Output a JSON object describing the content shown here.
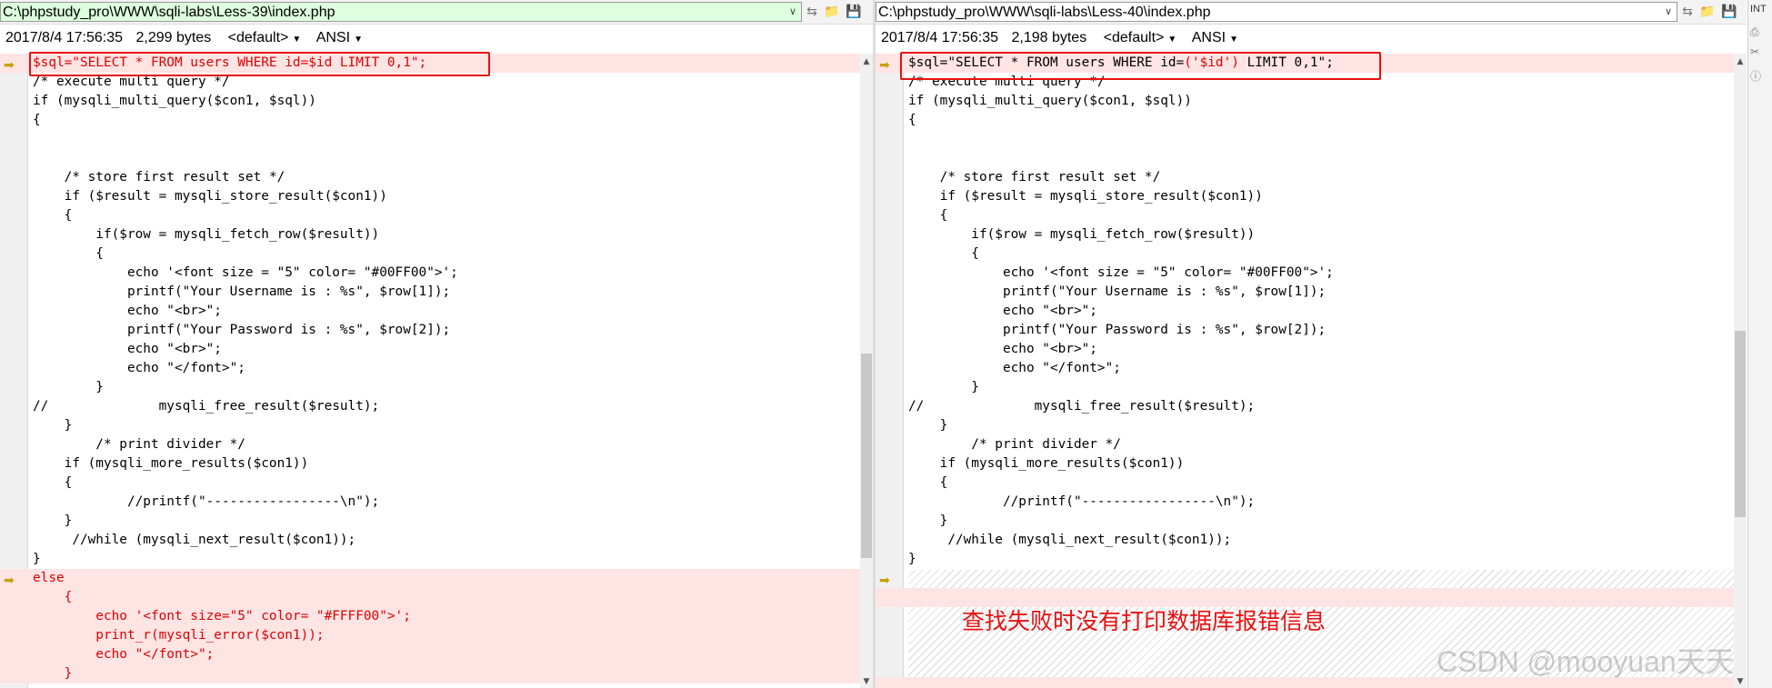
{
  "left": {
    "path": "C:\\phpstudy_pro\\WWW\\sqli-labs\\Less-39\\index.php",
    "timestamp": "2017/8/4 17:56:35",
    "size": "2,299 bytes",
    "view_mode": "<default>",
    "encoding": "ANSI",
    "lines": [
      "$sql=\"SELECT * FROM users WHERE id=$id LIMIT 0,1\";",
      "/* execute multi query */",
      "if (mysqli_multi_query($con1, $sql))",
      "{",
      "",
      "",
      "    /* store first result set */",
      "    if ($result = mysqli_store_result($con1))",
      "    {",
      "        if($row = mysqli_fetch_row($result))",
      "        {",
      "            echo '<font size = \"5\" color= \"#00FF00\">';",
      "            printf(\"Your Username is : %s\", $row[1]);",
      "            echo \"<br>\";",
      "            printf(\"Your Password is : %s\", $row[2]);",
      "            echo \"<br>\";",
      "            echo \"</font>\";",
      "        }",
      "//              mysqli_free_result($result);",
      "    }",
      "        /* print divider */",
      "    if (mysqli_more_results($con1))",
      "    {",
      "            //printf(\"-----------------\\n\");",
      "    }",
      "     //while (mysqli_next_result($con1));",
      "}",
      "else",
      "    {",
      "        echo '<font size=\"5\" color= \"#FFFF00\">';",
      "        print_r(mysqli_error($con1));",
      "        echo \"</font>\";",
      "    }"
    ]
  },
  "right": {
    "path": "C:\\phpstudy_pro\\WWW\\sqli-labs\\Less-40\\index.php",
    "timestamp": "2017/8/4 17:56:35",
    "size": "2,198 bytes",
    "view_mode": "<default>",
    "encoding": "ANSI",
    "sql_prefix": "$sql=\"SELECT * FROM users WHERE id=",
    "sql_changed": "('$id')",
    "sql_suffix": " LIMIT 0,1\";",
    "lines": [
      "",
      "/* execute multi query */",
      "if (mysqli_multi_query($con1, $sql))",
      "{",
      "",
      "",
      "    /* store first result set */",
      "    if ($result = mysqli_store_result($con1))",
      "    {",
      "        if($row = mysqli_fetch_row($result))",
      "        {",
      "            echo '<font size = \"5\" color= \"#00FF00\">';",
      "            printf(\"Your Username is : %s\", $row[1]);",
      "            echo \"<br>\";",
      "            printf(\"Your Password is : %s\", $row[2]);",
      "            echo \"<br>\";",
      "            echo \"</font>\";",
      "        }",
      "//              mysqli_free_result($result);",
      "    }",
      "        /* print divider */",
      "    if (mysqli_more_results($con1))",
      "    {",
      "            //printf(\"-----------------\\n\");",
      "    }",
      "     //while (mysqli_next_result($con1));",
      "}"
    ]
  },
  "annotation": "查找失败时没有打印数据库报错信息",
  "watermark": "CSDN @mooyuan天天",
  "side_label": "INT",
  "icons": [
    "dropdown-icon",
    "nav-arrows-icon",
    "open-folder-icon",
    "save-icon",
    "diff-arrow-icon"
  ],
  "colors": {
    "diff_bg": "#ffe4e4",
    "diff_text": "#e00000",
    "highlight_box": "#e81010",
    "left_path_bg": "#ddffdd"
  }
}
